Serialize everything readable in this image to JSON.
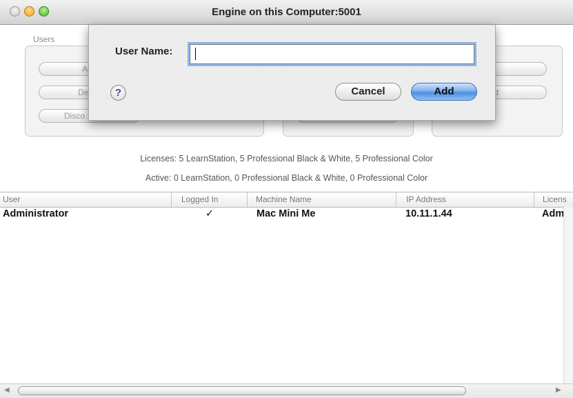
{
  "window": {
    "title": "Engine on this Computer:5001"
  },
  "users_group": {
    "label": "Users",
    "buttons": [
      "Ac",
      "Dele",
      "Disco"
    ]
  },
  "settings_group": {
    "buttons": [
      "ttings",
      "ssword"
    ]
  },
  "licenses": {
    "licenses_line": "Licenses: 5 LearnStation, 5 Professional Black & White, 5 Professional Color",
    "active_line": "Active: 0 LearnStation, 0 Professional Black & White, 0 Professional Color"
  },
  "table": {
    "columns": [
      "User",
      "Logged In",
      "Machine Name",
      "IP Address",
      "Licens"
    ],
    "rows": [
      {
        "user": "Administrator",
        "logged_in": "✓",
        "machine": "Mac Mini Me",
        "ip": "10.11.1.44",
        "license": "Adm"
      }
    ]
  },
  "sheet": {
    "label": "User Name:",
    "input_value": "",
    "help_glyph": "?",
    "cancel_label": "Cancel",
    "add_label": "Add"
  },
  "colors": {
    "accent": "#4d8fe0",
    "focus_ring": "#8fb4e6"
  },
  "icons": [
    "close-light-icon",
    "minimize-light-icon",
    "zoom-light-icon",
    "help-icon",
    "checkmark-icon",
    "scroll-left-arrow-icon",
    "scroll-right-arrow-icon"
  ]
}
